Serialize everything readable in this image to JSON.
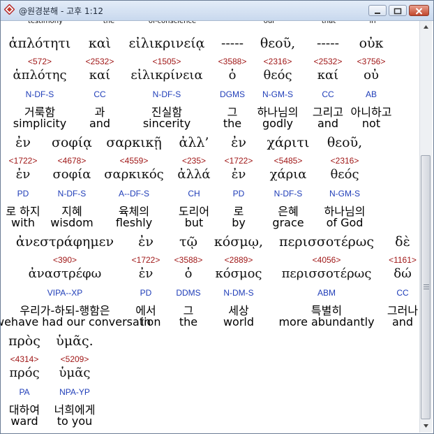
{
  "window": {
    "title": "@원경분해 - 고후 1:12",
    "top_strip": [
      "testimony",
      "the",
      "of-conscience",
      "our",
      "that",
      "in"
    ]
  },
  "rows": [
    {
      "words": [
        {
          "greek": "ἁπλότητι",
          "strong": "<572>",
          "lemma": "ἁπλότης",
          "parse": "N-DF-S",
          "korean": "거룩함",
          "english": "simplicity"
        },
        {
          "greek": "καὶ",
          "strong": "<2532>",
          "lemma": "καί",
          "parse": "CC",
          "korean": "과",
          "english": "and"
        },
        {
          "greek": "εἰλικρινείᾳ",
          "strong": "<1505>",
          "lemma": "εἰλικρίνεια",
          "parse": "N-DF-S",
          "korean": "진실함",
          "english": "sincerity"
        },
        {
          "greek": "-----",
          "strong": "<3588>",
          "lemma": "ὁ",
          "parse": "DGMS",
          "korean": "그",
          "english": "the"
        },
        {
          "greek": "θεοῦ,",
          "strong": "<2316>",
          "lemma": "θεός",
          "parse": "N-GM-S",
          "korean": "하나님의",
          "english": "godly"
        },
        {
          "greek": "-----",
          "strong": "<2532>",
          "lemma": "καί",
          "parse": "CC",
          "korean": "그리고",
          "english": "and"
        },
        {
          "greek": "οὐκ",
          "strong": "<3756>",
          "lemma": "οὐ",
          "parse": "AB",
          "korean": "아니하고",
          "english": "not"
        }
      ]
    },
    {
      "words": [
        {
          "greek": "ἐν",
          "strong": "<1722>",
          "lemma": "ἐν",
          "parse": "PD",
          "korean": "로 하지",
          "english": "with"
        },
        {
          "greek": "σοφίᾳ",
          "strong": "<4678>",
          "lemma": "σοφία",
          "parse": "N-DF-S",
          "korean": "지혜",
          "english": "wisdom"
        },
        {
          "greek": "σαρκικῇ",
          "strong": "<4559>",
          "lemma": "σαρκικός",
          "parse": "A--DF-S",
          "korean": "육체의",
          "english": "fleshly"
        },
        {
          "greek": "ἀλλ’",
          "strong": "<235>",
          "lemma": "ἀλλά",
          "parse": "CH",
          "korean": "도리어",
          "english": "but"
        },
        {
          "greek": "ἐν",
          "strong": "<1722>",
          "lemma": "ἐν",
          "parse": "PD",
          "korean": "로",
          "english": "by"
        },
        {
          "greek": "χάριτι",
          "strong": "<5485>",
          "lemma": "χάρια",
          "parse": "N-DF-S",
          "korean": "은혜",
          "english": "grace"
        },
        {
          "greek": "θεοῦ,",
          "strong": "<2316>",
          "lemma": "θεός",
          "parse": "N-GM-S",
          "korean": "하나님의",
          "english": "of God"
        }
      ]
    },
    {
      "words": [
        {
          "greek": "ἀνεστράφημεν",
          "strong": "<390>",
          "lemma": "ἀναστρέφω",
          "parse": "VIPA--XP",
          "korean": "우리가-하되-행함은",
          "english": "wehave had our conversation"
        },
        {
          "greek": "ἐν",
          "strong": "<1722>",
          "lemma": "ἐν",
          "parse": "PD",
          "korean": "에서",
          "english": "in"
        },
        {
          "greek": "τῷ",
          "strong": "<3588>",
          "lemma": "ὁ",
          "parse": "DDMS",
          "korean": "그",
          "english": "the"
        },
        {
          "greek": "κόσμῳ,",
          "strong": "<2889>",
          "lemma": "κόσμος",
          "parse": "N-DM-S",
          "korean": "세상",
          "english": "world"
        },
        {
          "greek": "περισσοτέρως",
          "strong": "<4056>",
          "lemma": "περισσοτέρως",
          "parse": "ABM",
          "korean": "특별히",
          "english": "more abundantly"
        },
        {
          "greek": "δὲ",
          "strong": "<1161>",
          "lemma": "δώ",
          "parse": "CC",
          "korean": "그러나",
          "english": "and"
        }
      ]
    },
    {
      "words": [
        {
          "greek": "πρὸς",
          "strong": "<4314>",
          "lemma": "πρός",
          "parse": "PA",
          "korean": "대하여",
          "english": "ward"
        },
        {
          "greek": "ὑμᾶς.",
          "strong": "<5209>",
          "lemma": "ὑμᾶς",
          "parse": "NPA-YP",
          "korean": "너희에게",
          "english": "to you"
        }
      ]
    }
  ]
}
